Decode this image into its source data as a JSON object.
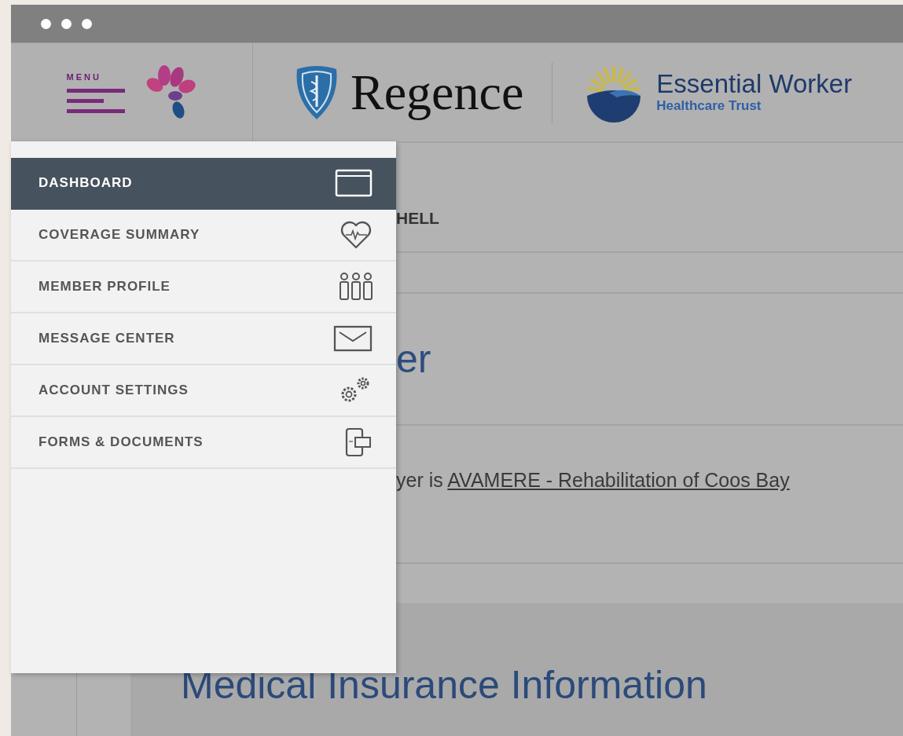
{
  "header": {
    "menu_label": "MENU",
    "brand": "Regence",
    "partner_name": "Essential Worker",
    "partner_subtitle": "Healthcare Trust"
  },
  "nav_menu": {
    "items": [
      {
        "label": "DASHBOARD",
        "kind": "browser",
        "selected": true
      },
      {
        "label": "COVERAGE SUMMARY",
        "kind": "heart",
        "selected": false
      },
      {
        "label": "MEMBER PROFILE",
        "kind": "people",
        "selected": false
      },
      {
        "label": "MESSAGE CENTER",
        "kind": "envelope",
        "selected": false
      },
      {
        "label": "ACCOUNT SETTINGS",
        "kind": "gears",
        "selected": false
      },
      {
        "label": "FORMS & DOCUMENTS",
        "kind": "document",
        "selected": false
      }
    ]
  },
  "page": {
    "member_name_fragment": "HELL",
    "title_fragment": "er",
    "employer_prefix": "yer is ",
    "employer_link": "AVAMERE - Rehabilitation of Coos Bay",
    "section_title": "Medical Insurance Information"
  }
}
